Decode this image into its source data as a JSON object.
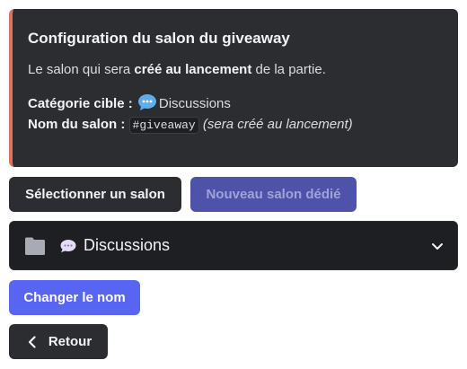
{
  "embed": {
    "accent_color": "#e0705a",
    "title": "Configuration du salon du giveaway",
    "desc_prefix": "Le salon qui sera ",
    "desc_bold": "créé au lancement",
    "desc_suffix": " de la partie.",
    "category_label": "Catégorie cible :",
    "category_icon": "speech-bubble-emoji",
    "category_value": "Discussions",
    "name_label": "Nom du salon :",
    "name_code": "#giveaway",
    "name_note": "(sera créé au lancement)"
  },
  "buttons": {
    "select_channel": "Sélectionner un salon",
    "new_channel": "Nouveau salon dédié",
    "change_name": "Changer le nom",
    "back": "Retour"
  },
  "category_select": {
    "icon": "folder-icon",
    "emoji": "speech-bubble-emoji",
    "value": "Discussions"
  },
  "colors": {
    "embed_bg": "#2b2d31",
    "blurple": "#5865f2",
    "disabled": "#4e52a8"
  }
}
